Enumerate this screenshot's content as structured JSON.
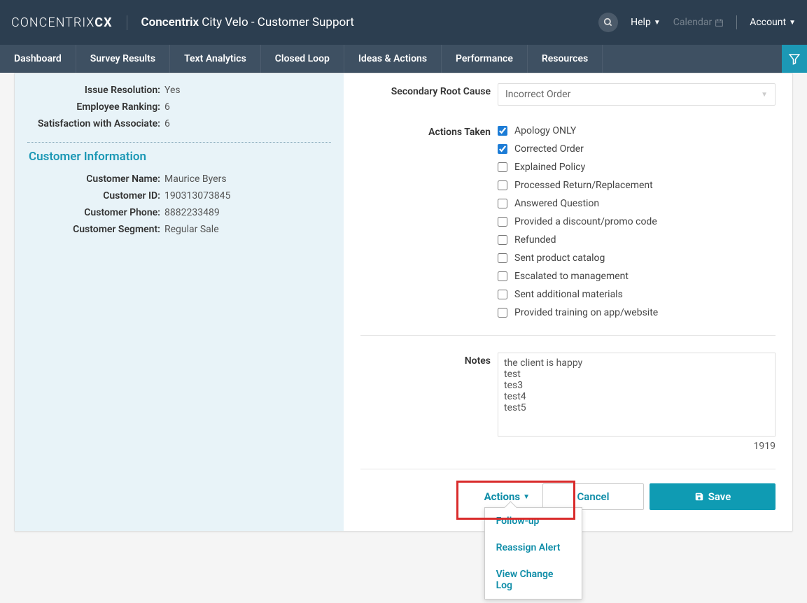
{
  "header": {
    "logo_prefix": "CONCENTRIX",
    "logo_suffix": "CX",
    "brand_bold": "Concentrix",
    "brand_rest": " City Velo - Customer Support",
    "help": "Help",
    "calendar": "Calendar",
    "account": "Account"
  },
  "nav": [
    "Dashboard",
    "Survey Results",
    "Text Analytics",
    "Closed Loop",
    "Ideas & Actions",
    "Performance",
    "Resources"
  ],
  "left": {
    "rows": [
      {
        "label": "Issue Resolution:",
        "value": "Yes"
      },
      {
        "label": "Employee Ranking:",
        "value": "6"
      },
      {
        "label": "Satisfaction with Associate:",
        "value": "6"
      }
    ],
    "section_title": "Customer Information",
    "customer_rows": [
      {
        "label": "Customer Name:",
        "value": "Maurice Byers"
      },
      {
        "label": "Customer ID:",
        "value": "190313073845"
      },
      {
        "label": "Customer Phone:",
        "value": "8882233489"
      },
      {
        "label": "Customer Segment:",
        "value": "Regular Sale"
      }
    ]
  },
  "right": {
    "secondary_root_cause_label": "Secondary Root Cause",
    "secondary_root_cause_value": "Incorrect Order",
    "actions_taken_label": "Actions Taken",
    "actions_taken": [
      {
        "label": "Apology ONLY",
        "checked": true
      },
      {
        "label": "Corrected Order",
        "checked": true
      },
      {
        "label": "Explained Policy",
        "checked": false
      },
      {
        "label": "Processed Return/Replacement",
        "checked": false
      },
      {
        "label": "Answered Question",
        "checked": false
      },
      {
        "label": "Provided a discount/promo code",
        "checked": false
      },
      {
        "label": "Refunded",
        "checked": false
      },
      {
        "label": "Sent product catalog",
        "checked": false
      },
      {
        "label": "Escalated to management",
        "checked": false
      },
      {
        "label": "Sent additional materials",
        "checked": false
      },
      {
        "label": "Provided training on app/website",
        "checked": false
      }
    ],
    "notes_label": "Notes",
    "notes_value": "the client is happy\ntest\ntes3\ntest4\ntest5",
    "char_count": "1919",
    "actions_trigger": "Actions",
    "cancel": "Cancel",
    "save": "Save",
    "dropdown": [
      "Follow-up",
      "Reassign Alert",
      "View Change Log"
    ]
  }
}
